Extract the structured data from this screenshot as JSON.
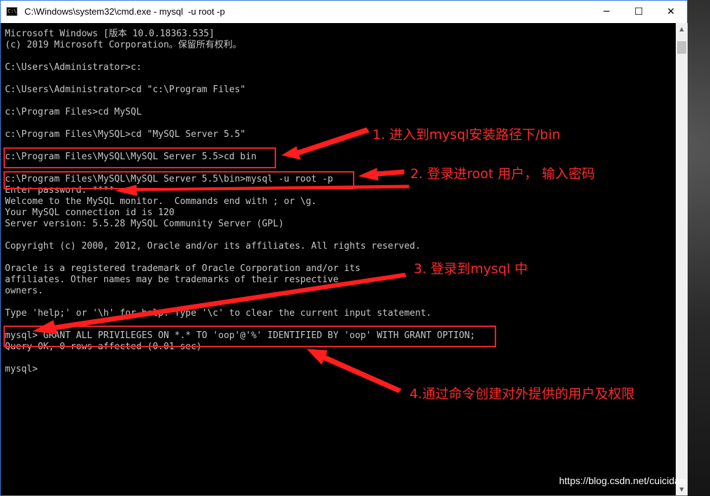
{
  "window": {
    "title": "C:\\Windows\\system32\\cmd.exe - mysql  -u root -p",
    "icon_label": "C:\\",
    "minimize_glyph": "─",
    "maximize_glyph": "☐",
    "close_glyph": "✕"
  },
  "console": {
    "lines": [
      "Microsoft Windows [版本 10.0.18363.535]",
      "(c) 2019 Microsoft Corporation。保留所有权利。",
      "",
      "C:\\Users\\Administrator>c:",
      "",
      "C:\\Users\\Administrator>cd \"c:\\Program Files\"",
      "",
      "c:\\Program Files>cd MySQL",
      "",
      "c:\\Program Files\\MySQL>cd \"MySQL Server 5.5\"",
      "",
      "c:\\Program Files\\MySQL\\MySQL Server 5.5>cd bin",
      "",
      "c:\\Program Files\\MySQL\\MySQL Server 5.5\\bin>mysql -u root -p",
      "Enter password: ****",
      "Welcome to the MySQL monitor.  Commands end with ; or \\g.",
      "Your MySQL connection id is 120",
      "Server version: 5.5.28 MySQL Community Server (GPL)",
      "",
      "Copyright (c) 2000, 2012, Oracle and/or its affiliates. All rights reserved.",
      "",
      "Oracle is a registered trademark of Oracle Corporation and/or its",
      "affiliates. Other names may be trademarks of their respective",
      "owners.",
      "",
      "Type 'help;' or '\\h' for help. Type '\\c' to clear the current input statement.",
      "",
      "mysql> GRANT ALL PRIVILEGES ON *.* TO 'oop'@'%' IDENTIFIED BY 'oop' WITH GRANT OPTION;",
      "Query OK, 0 rows affected (0.01 sec)",
      "",
      "mysql>"
    ]
  },
  "annotations": {
    "step1": "1. 进入到mysql安装路径下/bin",
    "step2": "2. 登录进root 用户， 输入密码",
    "step3": "3. 登录到mysql 中",
    "step4": "4.通过命令创建对外提供的用户及权限",
    "color": "#ff2a2a"
  },
  "scrollbar": {
    "up_glyph": "▲",
    "down_glyph": "▼"
  },
  "watermark": "https://blog.csdn.net/cuicidan"
}
